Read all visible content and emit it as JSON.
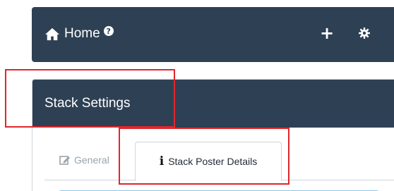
{
  "home_bar": {
    "title": "Home",
    "help_glyph": "?",
    "icons": [
      "home-icon",
      "help-icon",
      "plus-icon",
      "gear-icon"
    ],
    "add_glyph": "+"
  },
  "panel": {
    "title": "Stack Settings",
    "tabs": [
      {
        "label": "General",
        "icon": "edit-icon",
        "active": false
      },
      {
        "label": "Stack Poster Details",
        "icon": "info-icon",
        "active": true
      }
    ]
  },
  "colors": {
    "header_bg": "#2e4054",
    "annotation": "#e0262b",
    "content_accent": "#8cc9ea"
  }
}
